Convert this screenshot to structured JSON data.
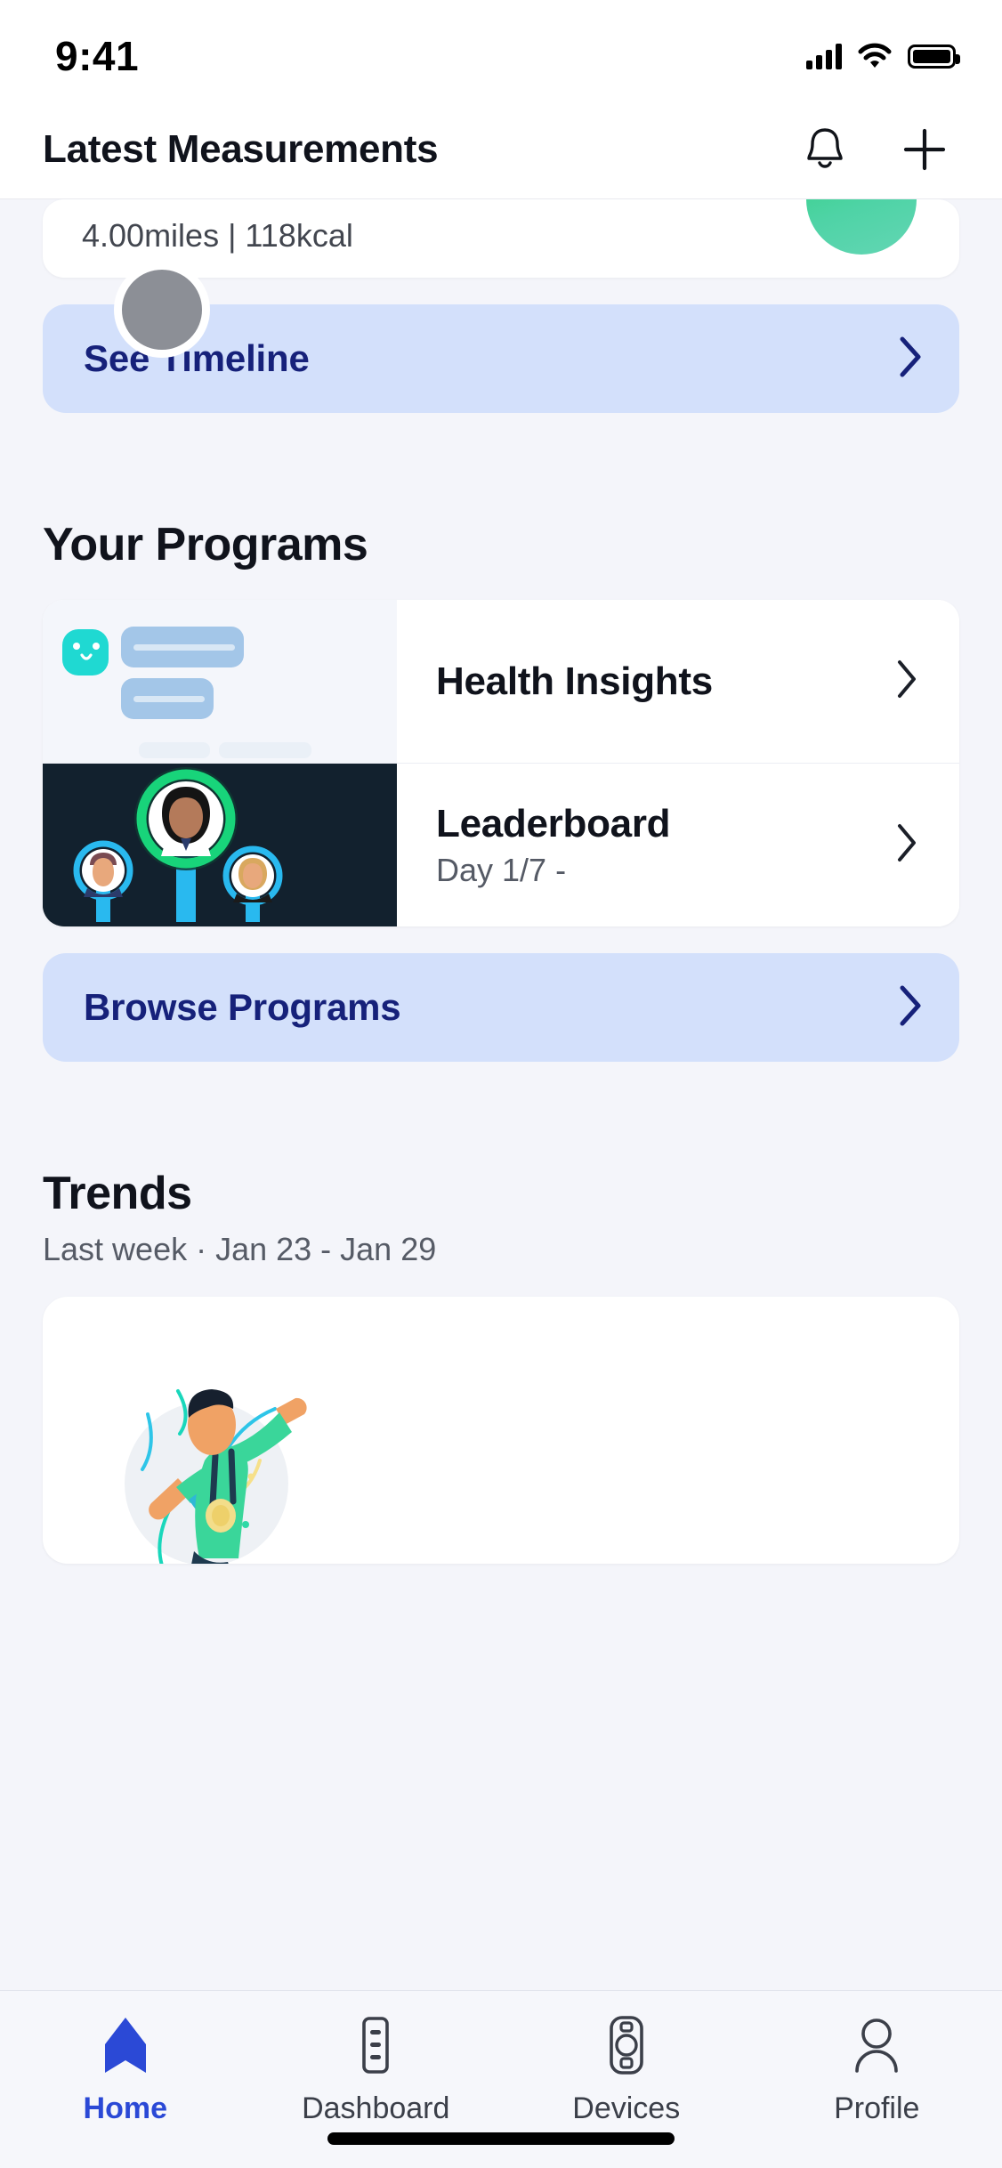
{
  "status_bar": {
    "time": "9:41",
    "icons": [
      "cellular-signal-icon",
      "wifi-icon",
      "battery-icon"
    ]
  },
  "header": {
    "title": "Latest Measurements",
    "notification_icon": "bell-icon",
    "add_icon": "plus-icon"
  },
  "measurement_card": {
    "clipped_line": "",
    "stats": "4.00miles | 118kcal",
    "avatar_icon": "glasses-avatar-icon",
    "avatar_color": "#35d289"
  },
  "see_timeline": {
    "label": "See Timeline",
    "chevron_icon": "chevron-right-icon",
    "background": "#d3e0fb",
    "text_color": "#16217a"
  },
  "cursor": {
    "name": "pointer-blob",
    "color": "#8c8f96"
  },
  "programs": {
    "section_title": "Your Programs",
    "items": [
      {
        "title": "Health Insights",
        "subtitle": "",
        "thumb": "insights-illustration",
        "chevron_icon": "chevron-right-icon"
      },
      {
        "title": "Leaderboard",
        "subtitle": "Day 1/7 -",
        "thumb": "leaderboard-illustration",
        "chevron_icon": "chevron-right-icon"
      }
    ],
    "browse": {
      "label": "Browse Programs",
      "chevron_icon": "chevron-right-icon"
    }
  },
  "trends": {
    "section_title": "Trends",
    "subtitle": "Last week · Jan 23 - Jan 29",
    "illustration": "celebrating-athlete-with-medal-illustration"
  },
  "tabbar": {
    "items": [
      {
        "label": "Home",
        "icon": "home-arrow-icon",
        "active": true
      },
      {
        "label": "Dashboard",
        "icon": "dashboard-list-icon",
        "active": false
      },
      {
        "label": "Devices",
        "icon": "smartwatch-icon",
        "active": false
      },
      {
        "label": "Profile",
        "icon": "person-icon",
        "active": false
      }
    ],
    "active_color": "#2b49d6",
    "inactive_color": "#3b3f49"
  }
}
